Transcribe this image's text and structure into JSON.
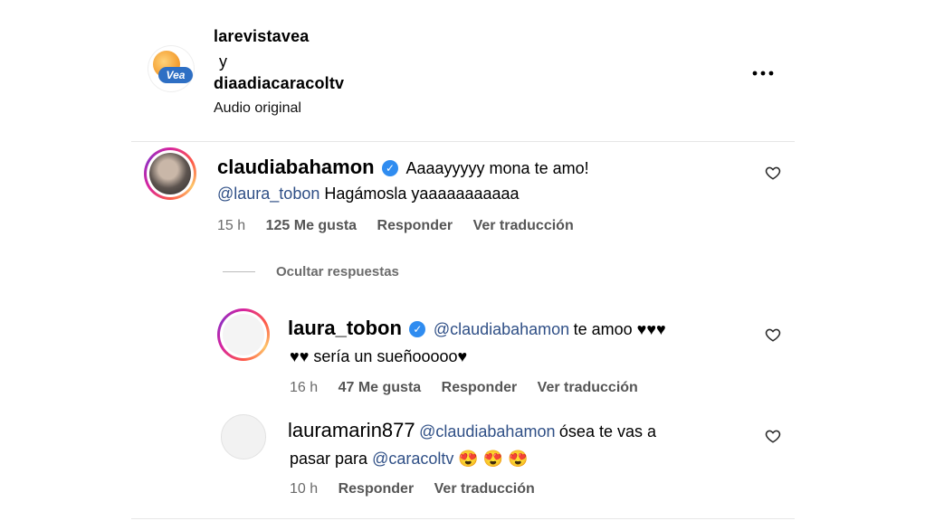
{
  "header": {
    "account1": "larevistavea",
    "connector": "y",
    "account2": "diaadiacaracoltv",
    "audio": "Audio original",
    "logo_text": "Vea",
    "more_label": "..."
  },
  "comments": [
    {
      "user": "claudiabahamon",
      "text_line1": "Aaaayyyyy mona te amo!",
      "mention": "@laura_tobon",
      "text_line2": "Hagámosla yaaaaaaaaaaa",
      "time": "15 h",
      "likes": "125 Me gusta",
      "reply": "Responder",
      "translate": "Ver traducción"
    }
  ],
  "hide_replies": "Ocultar respuestas",
  "replies": [
    {
      "user": "laura_tobon",
      "mention": "@claudiabahamon",
      "text_line1": "te amoo ♥♥♥",
      "text_line2": "♥♥ sería un sueñooooo♥",
      "time": "16 h",
      "likes": "47 Me gusta",
      "reply": "Responder",
      "translate": "Ver traducción"
    },
    {
      "user": "lauramarin877",
      "mention": "@claudiabahamon",
      "text_line1": "ósea te vas a",
      "text_line2_pre": "pasar para",
      "mention2": "@caracoltv",
      "emojis": "😍 😍 😍",
      "time": "10 h",
      "reply": "Responder",
      "translate": "Ver traducción"
    }
  ],
  "colors": {
    "mention": "#2f4f86",
    "verified": "#2f8cf0",
    "meta": "#6b6b6b"
  }
}
